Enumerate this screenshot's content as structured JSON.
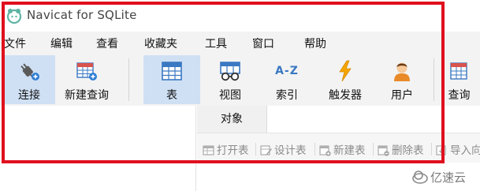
{
  "window": {
    "title": "Navicat for SQLite"
  },
  "menu": [
    "文件",
    "编辑",
    "查看",
    "收藏夹",
    "工具",
    "窗口",
    "帮助"
  ],
  "toolbar": {
    "connect": "连接",
    "new_query": "新建查询",
    "table": "表",
    "view": "视图",
    "index": "索引",
    "trigger": "触发器",
    "user": "用户",
    "query": "查询",
    "index_icon_text": "A-Z"
  },
  "objects_tab": {
    "label": "对象"
  },
  "object_toolbar": {
    "open_table": "打开表",
    "design_table": "设计表",
    "new_table": "新建表",
    "delete_table": "删除表",
    "import": "导入向"
  },
  "watermark": {
    "text": "亿速云"
  },
  "colors": {
    "annotation": "#e0101e",
    "active_tool": "#cfe0f4",
    "trigger": "#f5a500"
  }
}
